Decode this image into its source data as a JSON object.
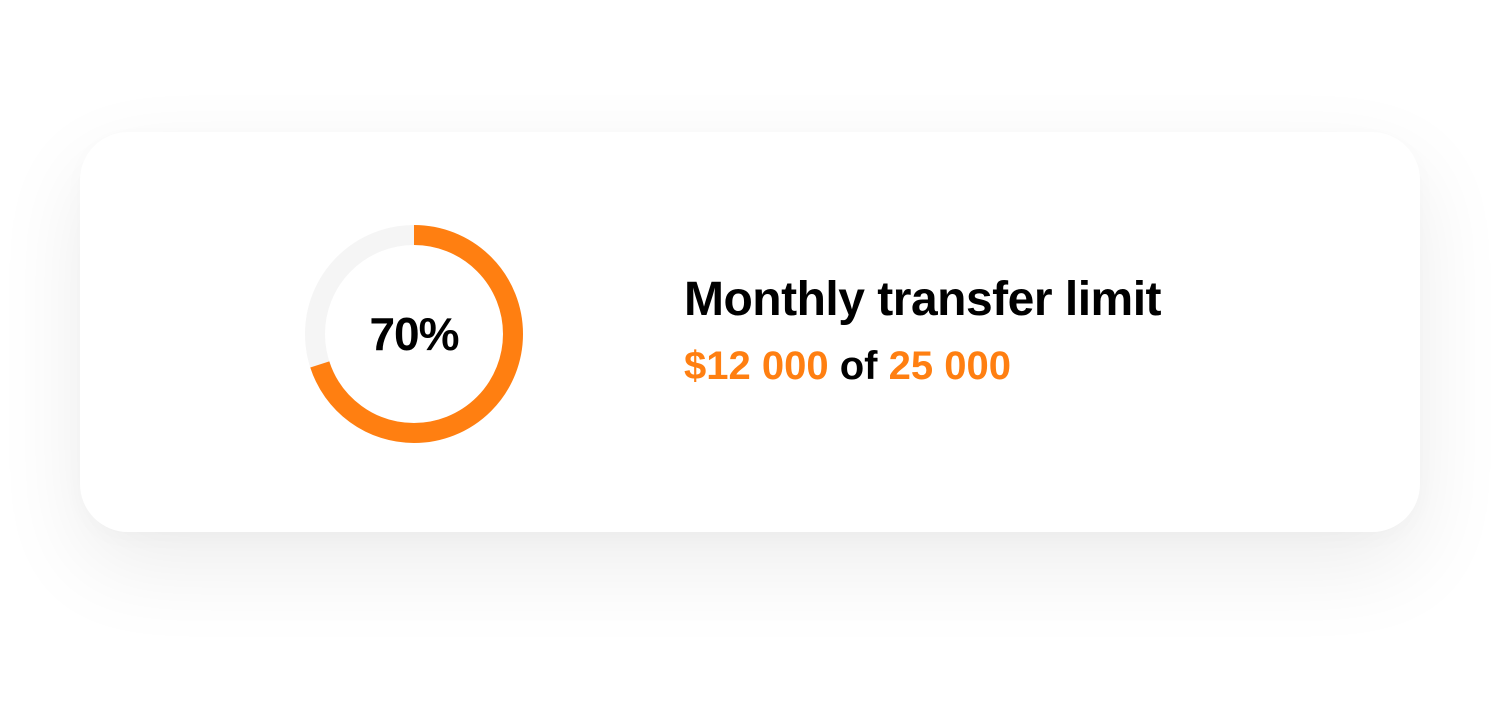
{
  "colors": {
    "accent": "#FF7F11",
    "track": "#F5F5F5",
    "text": "#000000",
    "card": "#FFFFFF"
  },
  "progress": {
    "fraction": 0.7,
    "label": "70%"
  },
  "limit": {
    "title": "Monthly transfer limit",
    "used": "$12 000",
    "connector": "of",
    "total": "25 000"
  }
}
